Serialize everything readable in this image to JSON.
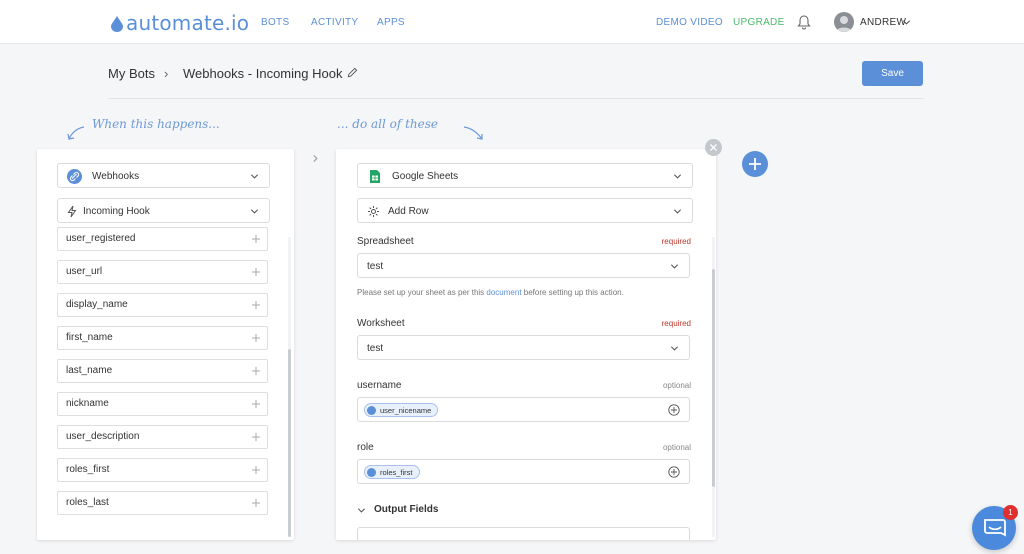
{
  "brand": {
    "logo_text": "automate.io",
    "accent": "#5b8fd8",
    "upgrade_color": "#4fba6f"
  },
  "nav": {
    "bots": "BOTS",
    "activity": "ACTIVITY",
    "apps": "APPS",
    "demo_video": "DEMO VIDEO",
    "upgrade": "UPGRADE",
    "user": "ANDREW"
  },
  "breadcrumb": {
    "root": "My Bots",
    "separator": "›",
    "title": "Webhooks - Incoming Hook"
  },
  "toolbar": {
    "save_label": "Save"
  },
  "hints": {
    "trigger": "When this happens...",
    "action": "... do all of these"
  },
  "trigger": {
    "app": "Webhooks",
    "event": "Incoming Hook",
    "fields": [
      "user_registered",
      "user_url",
      "display_name",
      "first_name",
      "last_name",
      "nickname",
      "user_description",
      "roles_first",
      "roles_last"
    ]
  },
  "action": {
    "app": "Google Sheets",
    "event": "Add Row",
    "spreadsheet": {
      "label": "Spreadsheet",
      "badge": "required",
      "value": "test"
    },
    "help": {
      "before": "Please set up your sheet as per this ",
      "link": "document",
      "after": " before setting up this action."
    },
    "worksheet": {
      "label": "Worksheet",
      "badge": "required",
      "value": "test"
    },
    "username": {
      "label": "username",
      "badge": "optional",
      "token": "user_nicename"
    },
    "role": {
      "label": "role",
      "badge": "optional",
      "token": "roles_first"
    },
    "output_fields": "Output Fields"
  },
  "chat": {
    "badge_count": "1"
  },
  "icons": [
    "link-icon",
    "bolt-icon",
    "sheets-icon",
    "gear-icon",
    "chevron-down-icon",
    "plus-icon",
    "circle-plus-icon",
    "close-icon",
    "bell-icon",
    "pencil-icon",
    "chat-icon"
  ]
}
